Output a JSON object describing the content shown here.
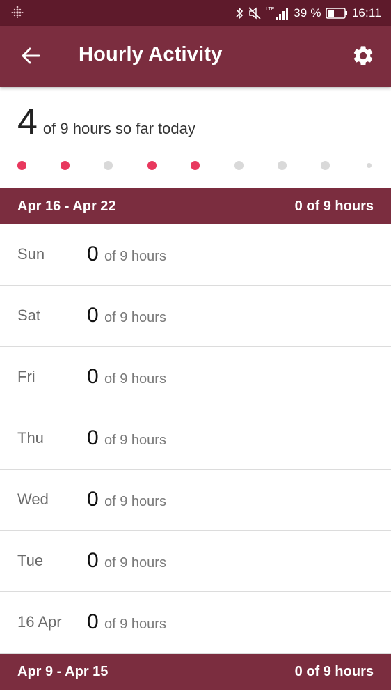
{
  "status_bar": {
    "network": "LTE",
    "battery": "39 %",
    "time": "16:11"
  },
  "app_bar": {
    "title": "Hourly Activity",
    "back_icon": "arrow-left-icon",
    "settings_icon": "gear-icon"
  },
  "summary": {
    "count": "4",
    "text": "of 9 hours so far today",
    "hours_active": [
      true,
      true,
      false,
      true,
      true,
      false,
      false,
      false,
      false
    ]
  },
  "weeks": [
    {
      "range": "Apr 16 - Apr 22",
      "total": "0 of 9 hours",
      "days": [
        {
          "label": "Sun",
          "count": "0",
          "of": "of 9 hours"
        },
        {
          "label": "Sat",
          "count": "0",
          "of": "of 9 hours"
        },
        {
          "label": "Fri",
          "count": "0",
          "of": "of 9 hours"
        },
        {
          "label": "Thu",
          "count": "0",
          "of": "of 9 hours"
        },
        {
          "label": "Wed",
          "count": "0",
          "of": "of 9 hours"
        },
        {
          "label": "Tue",
          "count": "0",
          "of": "of 9 hours"
        },
        {
          "label": "16 Apr",
          "count": "0",
          "of": "of 9 hours"
        }
      ]
    },
    {
      "range": "Apr 9 - Apr 15",
      "total": "0 of 9 hours"
    }
  ],
  "colors": {
    "status_bar": "#5e1a2b",
    "app_bar": "#7b2d3f",
    "active_dot": "#e8385e",
    "inactive_dot": "#d9d9d9"
  }
}
